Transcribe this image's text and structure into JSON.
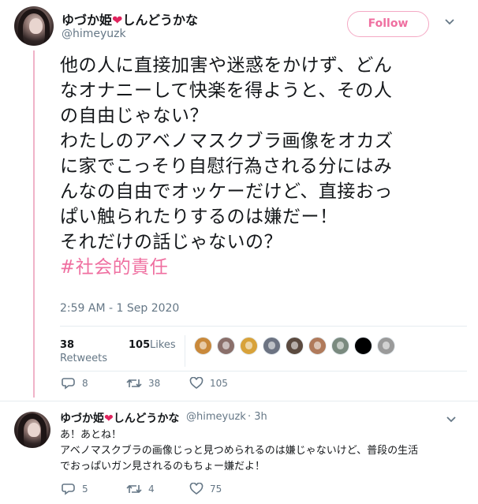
{
  "tweet": {
    "author": {
      "name_prefix": "ゆづか姫",
      "heart": "❤",
      "name_suffix": "しんどうかな",
      "handle": "@himeyuzk"
    },
    "follow_label": "Follow",
    "chevron": "⌄",
    "body_lines": [
      "他の人に直接加害や迷惑をかけず、どん",
      "なオナニーして快楽を得ようと、その人",
      "の自由じゃない？",
      "わたしのアベノマスクブラ画像をオカズ",
      "に家でこっそり自慰行為される分にはみ",
      "んなの自由でオッケーだけど、直接おっ",
      "ぱい触られたりするのは嫌だー！",
      "それだけの話じゃないの？"
    ],
    "hashtag": "#社会的責任",
    "timestamp": "2:59 AM - 1 Sep 2020",
    "retweets_count": "38",
    "retweets_label": "Retweets",
    "likes_count": "105",
    "likes_label": "Likes",
    "likers": [
      {
        "color": "#c9893b",
        "icon": "avatar-1"
      },
      {
        "color": "#8a6f6a",
        "icon": "avatar-2"
      },
      {
        "color": "#d8a23a",
        "icon": "avatar-3"
      },
      {
        "color": "#6c7382",
        "icon": "avatar-4"
      },
      {
        "color": "#5b4a3f",
        "icon": "avatar-5"
      },
      {
        "color": "#b07a5b",
        "icon": "avatar-6"
      },
      {
        "color": "#7a8a7f",
        "icon": "avatar-7"
      },
      {
        "color": "#000000",
        "icon": "avatar-8"
      },
      {
        "color": "#9a9a9a",
        "icon": "avatar-9"
      }
    ],
    "actions": {
      "replies": "8",
      "retweets": "38",
      "likes": "105"
    }
  },
  "reply": {
    "author": {
      "name_prefix": "ゆづか姫",
      "heart": "❤",
      "name_suffix": "しんどうかな",
      "handle": "@himeyuzk",
      "time": "· 3h"
    },
    "chevron": "⌄",
    "body_lines": [
      "あ！あとね！",
      "アベノマスクブラの画像じっと見つめられるのは嫌じゃないけど、普段の生活",
      "でおっぱいガン見されるのもちょー嫌だよ！"
    ],
    "actions": {
      "replies": "5",
      "retweets": "4",
      "likes": "75"
    }
  },
  "colors": {
    "accent_pink": "#ef6fa0",
    "like_heart": "#e0245e",
    "muted": "#657786",
    "divider": "#e6ecf0"
  }
}
